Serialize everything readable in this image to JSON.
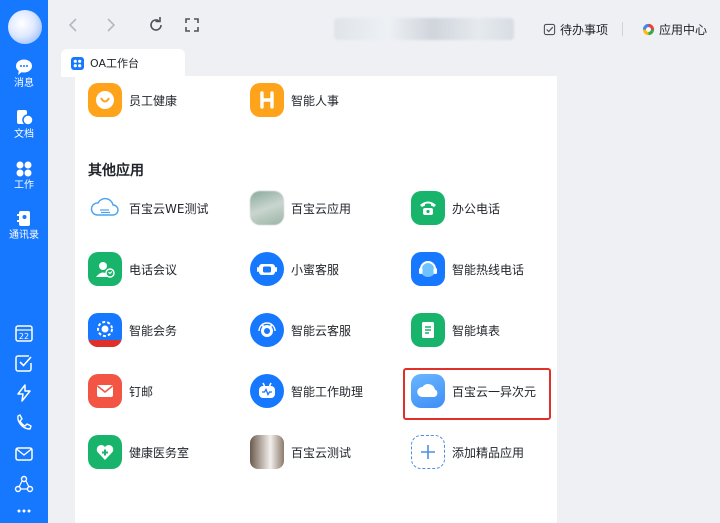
{
  "sidebar": {
    "items": [
      {
        "label": "消息",
        "icon": "message-icon"
      },
      {
        "label": "文档",
        "icon": "document-icon"
      },
      {
        "label": "工作",
        "icon": "workbench-icon"
      },
      {
        "label": "通讯录",
        "icon": "contacts-icon"
      }
    ],
    "bottom_icons": [
      "calendar-icon",
      "todo-check-icon",
      "lightning-icon",
      "phone-icon",
      "mail-icon",
      "org-icon",
      "more-icon"
    ],
    "calendar_day": "22"
  },
  "topbar": {
    "todo_label": "待办事项",
    "app_center_label": "应用中心"
  },
  "tab": {
    "title": "OA工作台"
  },
  "top_apps": [
    {
      "name": "员工健康"
    },
    {
      "name": "智能人事"
    }
  ],
  "section": {
    "title": "其他应用"
  },
  "apps": [
    {
      "name": "百宝云WE测试"
    },
    {
      "name": "百宝云应用"
    },
    {
      "name": "办公电话"
    },
    {
      "name": "电话会议"
    },
    {
      "name": "小蜜客服"
    },
    {
      "name": "智能热线电话"
    },
    {
      "name": "智能会务"
    },
    {
      "name": "智能云客服"
    },
    {
      "name": "智能填表"
    },
    {
      "name": "钉邮"
    },
    {
      "name": "智能工作助理"
    },
    {
      "name": "百宝云一异次元"
    },
    {
      "name": "健康医务室"
    },
    {
      "name": "百宝云测试"
    },
    {
      "name": "添加精品应用"
    }
  ],
  "colors": {
    "sidebar": "#1677ff",
    "highlight": "#e0302a",
    "orange": "#ffa31a",
    "green": "#18b46b",
    "blue": "#1677ff",
    "red": "#f25543"
  }
}
